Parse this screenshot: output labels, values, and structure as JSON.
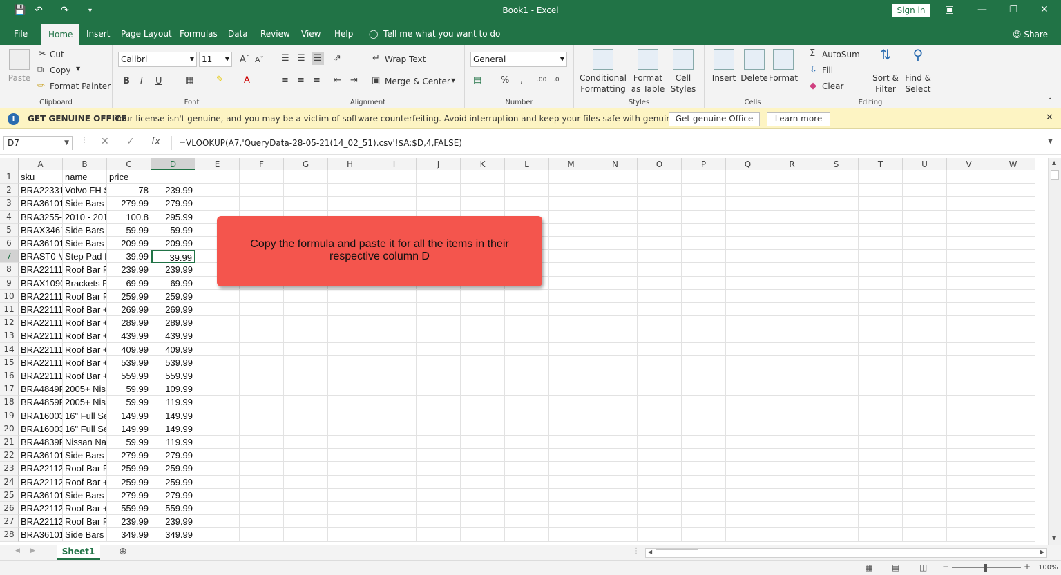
{
  "window": {
    "title": "Book1  -  Excel",
    "sign_in": "Sign in"
  },
  "tabs": [
    "File",
    "Home",
    "Insert",
    "Page Layout",
    "Formulas",
    "Data",
    "Review",
    "View",
    "Help"
  ],
  "tell_me": "Tell me what you want to do",
  "share": "Share",
  "ribbon": {
    "clipboard": {
      "label": "Clipboard",
      "paste": "Paste",
      "cut": "Cut",
      "copy": "Copy",
      "format_painter": "Format Painter"
    },
    "font": {
      "label": "Font",
      "name": "Calibri",
      "size": "11"
    },
    "alignment": {
      "label": "Alignment",
      "wrap_text": "Wrap Text",
      "merge_center": "Merge & Center"
    },
    "number": {
      "label": "Number",
      "format": "General"
    },
    "styles": {
      "label": "Styles",
      "conditional_formatting": "Conditional Formatting",
      "format_as_table": "Format as Table",
      "cell_styles": "Cell Styles"
    },
    "cells": {
      "label": "Cells",
      "insert": "Insert",
      "delete": "Delete",
      "format": "Format"
    },
    "editing": {
      "label": "Editing",
      "autosum": "AutoSum",
      "fill": "Fill",
      "clear": "Clear",
      "sort_filter": "Sort & Filter",
      "find_select": "Find & Select"
    }
  },
  "infobar": {
    "title": "GET GENUINE OFFICE",
    "message": "Your license isn't genuine, and you may be a victim of software counterfeiting. Avoid interruption and keep your files safe with genuine Office today.",
    "get_genuine": "Get genuine Office",
    "learn_more": "Learn more"
  },
  "formula_bar": {
    "name_box": "D7",
    "formula": "=VLOOKUP(A7,'QueryData-28-05-21(14_02_51).csv'!$A:$D,4,FALSE)"
  },
  "columns": [
    "A",
    "B",
    "C",
    "D",
    "E",
    "F",
    "G",
    "H",
    "I",
    "J",
    "K",
    "L",
    "M",
    "N",
    "O",
    "P",
    "Q",
    "R",
    "S",
    "T",
    "U",
    "V",
    "W"
  ],
  "rows": [
    [
      "1",
      "sku",
      "name",
      "price",
      ""
    ],
    [
      "2",
      "BRA22331",
      "Volvo FH S",
      "78",
      "239.99"
    ],
    [
      "3",
      "BRA36101",
      "Side Bars F",
      "279.99",
      "279.99"
    ],
    [
      "4",
      "BRA3255-I",
      "2010 - 201",
      "100.8",
      "295.99"
    ],
    [
      "5",
      "BRAX3461",
      "Side Bars E",
      "59.99",
      "59.99"
    ],
    [
      "6",
      "BRA36101",
      "Side Bars F",
      "209.99",
      "209.99"
    ],
    [
      "7",
      "BRAST0-V(",
      "Step Pad fo",
      "39.99",
      "39.99"
    ],
    [
      "8",
      "BRA22111",
      "Roof Bar F",
      "239.99",
      "239.99"
    ],
    [
      "9",
      "BRAX1090",
      "Brackets F",
      "69.99",
      "69.99"
    ],
    [
      "10",
      "BRA22111",
      "Roof Bar F",
      "259.99",
      "259.99"
    ],
    [
      "11",
      "BRA22111",
      "Roof Bar +",
      "269.99",
      "269.99"
    ],
    [
      "12",
      "BRA22111",
      "Roof Bar +",
      "289.99",
      "289.99"
    ],
    [
      "13",
      "BRA22111",
      "Roof Bar +",
      "439.99",
      "439.99"
    ],
    [
      "14",
      "BRA22111",
      "Roof Bar +",
      "409.99",
      "409.99"
    ],
    [
      "15",
      "BRA22111",
      "Roof Bar +",
      "539.99",
      "539.99"
    ],
    [
      "16",
      "BRA22111",
      "Roof Bar +",
      "559.99",
      "559.99"
    ],
    [
      "17",
      "BRA4849R",
      "2005+ Niss",
      "59.99",
      "109.99"
    ],
    [
      "18",
      "BRA4859R",
      "2005+ Niss",
      "59.99",
      "119.99"
    ],
    [
      "19",
      "BRA16003",
      "16\" Full Se",
      "149.99",
      "149.99"
    ],
    [
      "20",
      "BRA16003",
      "16\" Full Se",
      "149.99",
      "149.99"
    ],
    [
      "21",
      "BRA4839R",
      "Nissan Nav",
      "59.99",
      "119.99"
    ],
    [
      "22",
      "BRA36101",
      "Side Bars F",
      "279.99",
      "279.99"
    ],
    [
      "23",
      "BRA22112",
      "Roof Bar F",
      "259.99",
      "259.99"
    ],
    [
      "24",
      "BRA22112",
      "Roof Bar +",
      "259.99",
      "259.99"
    ],
    [
      "25",
      "BRA36101",
      "Side Bars F",
      "279.99",
      "279.99"
    ],
    [
      "26",
      "BRA22112",
      "Roof Bar +",
      "559.99",
      "559.99"
    ],
    [
      "27",
      "BRA22112",
      "Roof Bar F",
      "239.99",
      "239.99"
    ],
    [
      "28",
      "BRA36101",
      "Side Bars F",
      "349.99",
      "349.99"
    ]
  ],
  "active_cell": {
    "row": "7",
    "col": "D"
  },
  "callout": "Copy the formula and paste it for all the items in their respective column D",
  "sheet_tab": "Sheet1",
  "zoom": "100%",
  "colors": {
    "excel_green": "#217346",
    "callout": "#f4554d",
    "infobar": "#fdf4c3"
  }
}
